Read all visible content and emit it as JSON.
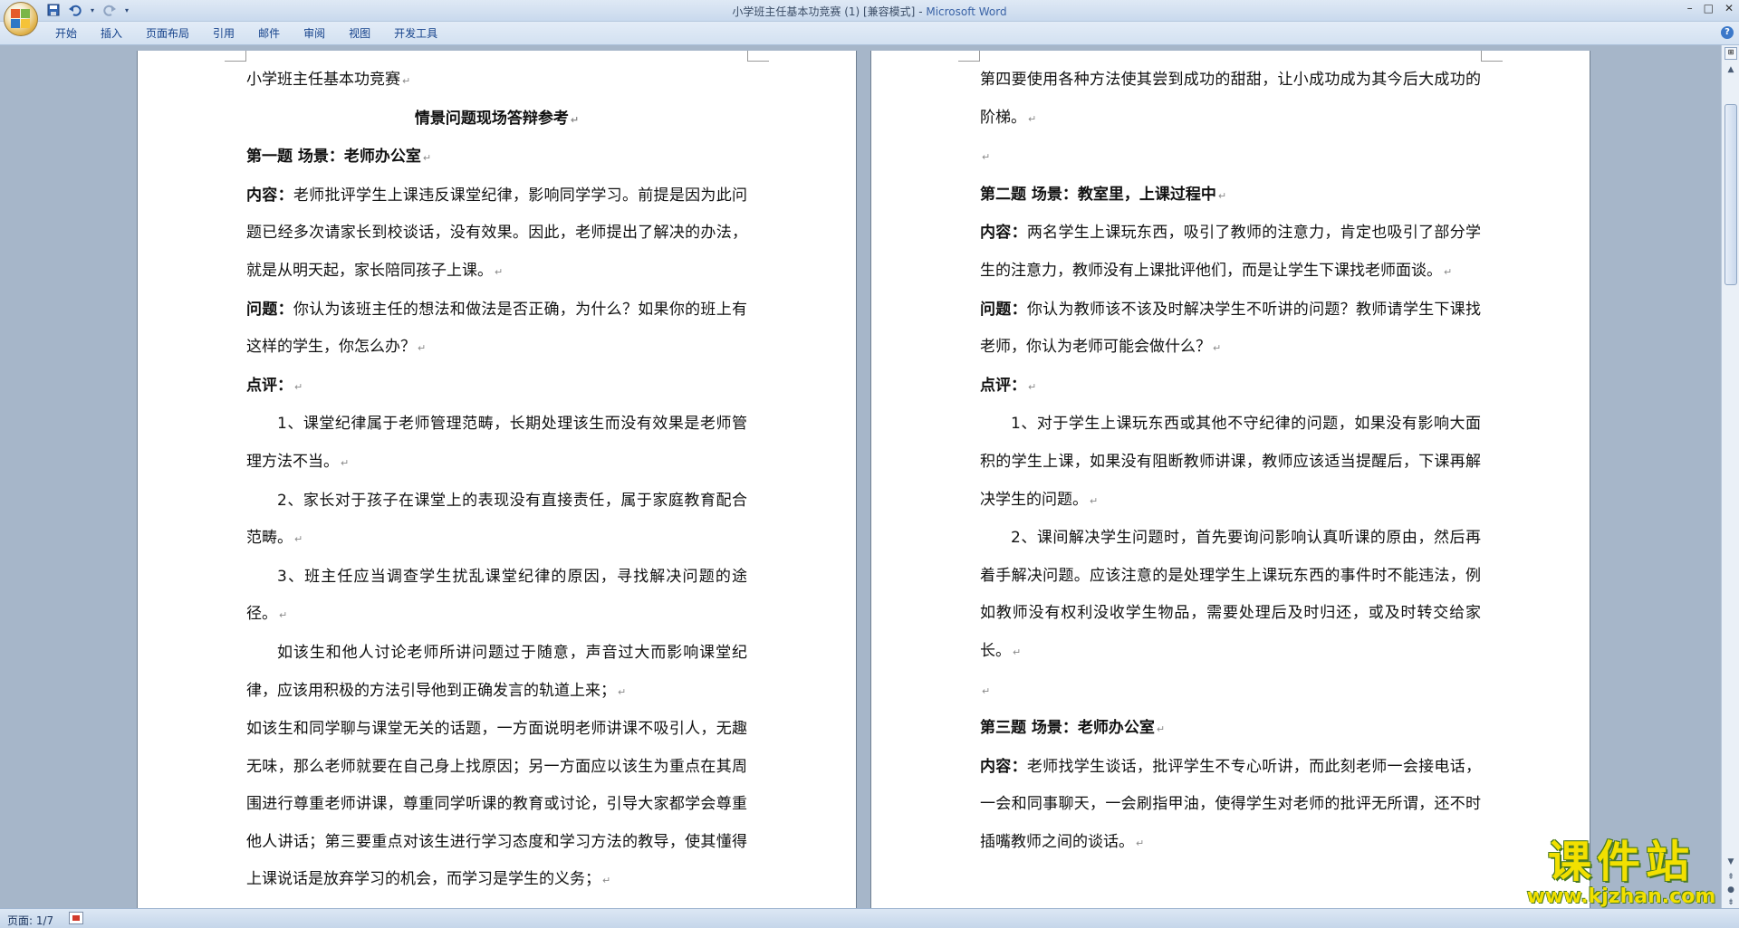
{
  "window": {
    "title": "小学班主任基本功竞赛 (1) [兼容模式]",
    "app_name": "Microsoft Word",
    "title_separator": " - ",
    "controls": [
      "–",
      "□",
      "✕"
    ]
  },
  "qat": {
    "save_icon": "save-icon",
    "undo_icon": "undo-icon",
    "redo_icon": "redo-icon",
    "customize_icon": "dropdown-icon"
  },
  "ribbon": {
    "tabs": [
      "开始",
      "插入",
      "页面布局",
      "引用",
      "邮件",
      "审阅",
      "视图",
      "开发工具"
    ],
    "help": "?"
  },
  "document": {
    "page1": [
      {
        "type": "plain",
        "text": "小学班主任基本功竞赛"
      },
      {
        "type": "center",
        "text": "情景问题现场答辩参考"
      },
      {
        "type": "heading",
        "text": "第一题 场景：老师办公室"
      },
      {
        "type": "labeled",
        "label": "内容：",
        "text": "老师批评学生上课违反课堂纪律，影响同学学习。前提是因为此问题已经多次请家长到校谈话，没有效果。因此，老师提出了解决的办法，就是从明天起，家长陪同孩子上课。"
      },
      {
        "type": "labeled",
        "label": "问题：",
        "text": "你认为该班主任的想法和做法是否正确，为什么？如果你的班上有这样的学生，你怎么办？"
      },
      {
        "type": "labeled",
        "label": "点评：",
        "text": ""
      },
      {
        "type": "indent",
        "text": "1、课堂纪律属于老师管理范畴，长期处理该生而没有效果是老师管理方法不当。"
      },
      {
        "type": "indent",
        "text": "2、家长对于孩子在课堂上的表现没有直接责任，属于家庭教育配合范畴。"
      },
      {
        "type": "indent",
        "text": "3、班主任应当调查学生扰乱课堂纪律的原因，寻找解决问题的途径。"
      },
      {
        "type": "indent",
        "text": "如该生和他人讨论老师所讲问题过于随意，声音过大而影响课堂纪律，应该用积极的方法引导他到正确发言的轨道上来；"
      },
      {
        "type": "plain-wrap",
        "text": "如该生和同学聊与课堂无关的话题，一方面说明老师讲课不吸引人，无趣无味，那么老师就要在自己身上找原因；另一方面应以该生为重点在其周围进行尊重老师讲课，尊重同学听课的教育或讨论，引导大家都学会尊重他人讲话；第三要重点对该生进行学习态度和学习方法的教导，使其懂得上课说话是放弃学习的机会，而学习是学生的义务；"
      }
    ],
    "page2": [
      {
        "type": "plain-wrap",
        "text": "第四要使用各种方法使其尝到成功的甜甜，让小成功成为其今后大成功的阶梯。"
      },
      {
        "type": "empty",
        "text": ""
      },
      {
        "type": "heading",
        "text": "第二题 场景：教室里，上课过程中"
      },
      {
        "type": "labeled",
        "label": "内容：",
        "text": "两名学生上课玩东西，吸引了教师的注意力，肯定也吸引了部分学生的注意力，教师没有上课批评他们，而是让学生下课找老师面谈。"
      },
      {
        "type": "labeled",
        "label": "问题：",
        "text": "你认为教师该不该及时解决学生不听讲的问题？教师请学生下课找老师，你认为老师可能会做什么？"
      },
      {
        "type": "labeled",
        "label": "点评：",
        "text": ""
      },
      {
        "type": "indent",
        "text": "1、对于学生上课玩东西或其他不守纪律的问题，如果没有影响大面积的学生上课，如果没有阻断教师讲课，教师应该适当提醒后，下课再解决学生的问题。"
      },
      {
        "type": "indent",
        "text": "2、课间解决学生问题时，首先要询问影响认真听课的原由，然后再着手解决问题。应该注意的是处理学生上课玩东西的事件时不能违法，例如教师没有权利没收学生物品，需要处理后及时归还，或及时转交给家长。"
      },
      {
        "type": "empty",
        "text": ""
      },
      {
        "type": "heading",
        "text": "第三题 场景：老师办公室"
      },
      {
        "type": "labeled",
        "label": "内容：",
        "text": "老师找学生谈话，批评学生不专心听讲，而此刻老师一会接电话，一会和同事聊天，一会刷指甲油，使得学生对老师的批评无所谓，还不时插嘴教师之间的谈话。"
      }
    ]
  },
  "status": {
    "page_count": "页面: 1/7"
  },
  "watermark": {
    "title": "课件站",
    "url": "www.kjzhan.com"
  },
  "marks": {
    "paragraph": "↵"
  }
}
